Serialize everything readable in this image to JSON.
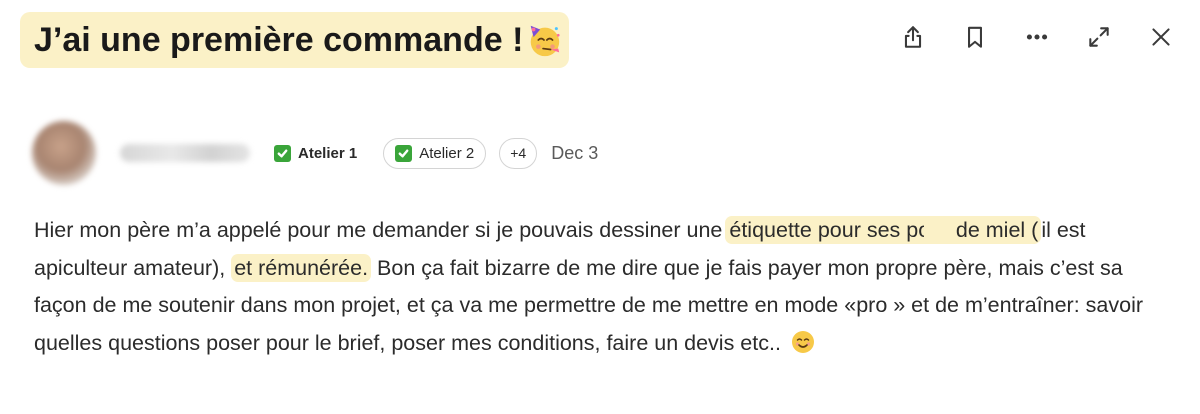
{
  "post": {
    "title": "J’ai une première commande !",
    "title_emoji": "partying-face-emoji",
    "date": "Dec 3",
    "badges": [
      {
        "label": "Atelier 1",
        "style": "plain"
      },
      {
        "label": "Atelier 2",
        "style": "outlined"
      }
    ],
    "more_badges_label": "+4",
    "body": {
      "seg1": "Hier mon père m’a appelé pour me demander si je pouvais dessiner une ",
      "hl1": "étiquette pour ses pots",
      "hl2": "de miel (",
      "seg2": "il est apiculteur amateur), ",
      "hl3": "et rémunérée.",
      "seg3": " Bon ça fait bizarre de me dire que je fais payer mon propre père, mais c’est sa façon de me soutenir dans mon projet, et ça va me permettre de me mettre en mode «pro » et de m’entraîner: savoir quelles questions poser pour le brief, poser mes conditions, faire un devis etc.. ",
      "end_emoji": "smiling-face-emoji"
    }
  },
  "toolbar": {
    "icons": [
      "share-icon",
      "bookmark-icon",
      "more-options-icon",
      "expand-icon",
      "close-icon"
    ]
  },
  "colors": {
    "highlight": "#fbf1c7",
    "badge_check": "#3aa53a",
    "text": "#2b2b2b"
  }
}
